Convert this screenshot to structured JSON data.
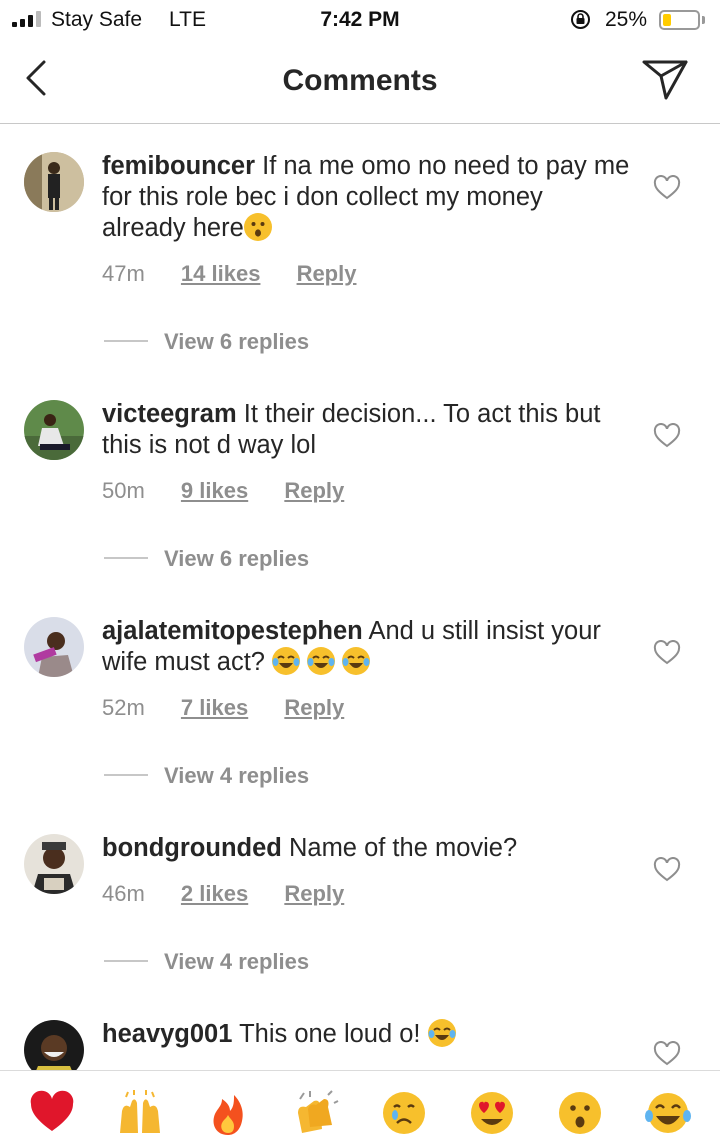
{
  "status_bar": {
    "carrier": "Stay Safe",
    "network": "LTE",
    "time": "7:42 PM",
    "battery_percent": "25%",
    "battery_level": 0.25
  },
  "nav": {
    "title": "Comments"
  },
  "comments": [
    {
      "username": "femibouncer",
      "text": "If na me omo no need to pay me for this role bec i don collect my money already here",
      "emoji": [
        "hushed-face"
      ],
      "time": "47m",
      "likes": "14 likes",
      "reply": "Reply",
      "view_replies": "View 6 replies"
    },
    {
      "username": "victeegram",
      "text": "It their decision... To act this but this is not d way lol",
      "emoji": [],
      "time": "50m",
      "likes": "9 likes",
      "reply": "Reply",
      "view_replies": "View 6 replies"
    },
    {
      "username": "ajalatemitopestephen",
      "text": "And u still insist your wife must act?",
      "emoji": [
        "tears-of-joy",
        "tears-of-joy",
        "tears-of-joy"
      ],
      "time": "52m",
      "likes": "7 likes",
      "reply": "Reply",
      "view_replies": "View 4 replies"
    },
    {
      "username": "bondgrounded",
      "text": "Name of the movie?",
      "emoji": [],
      "time": "46m",
      "likes": "2 likes",
      "reply": "Reply",
      "view_replies": "View 4 replies"
    },
    {
      "username": "heavyg001",
      "text": "This one loud o!",
      "emoji": [
        "tears-of-joy"
      ],
      "time": "",
      "likes": "",
      "reply": "",
      "view_replies": ""
    }
  ],
  "reactions": [
    {
      "name": "red-heart",
      "color": "#e0162b"
    },
    {
      "name": "raising-hands",
      "color": "#f5b731"
    },
    {
      "name": "fire",
      "color": "#f4511e"
    },
    {
      "name": "clapping-hands",
      "color": "#f5b731"
    },
    {
      "name": "crying-face",
      "color": "#f7c02c"
    },
    {
      "name": "heart-eyes",
      "color": "#f7c02c"
    },
    {
      "name": "hushed-face",
      "color": "#f7c02c"
    },
    {
      "name": "tears-of-joy",
      "color": "#f7c02c"
    }
  ],
  "colors": {
    "text": "#262626",
    "meta": "#8e8e8e",
    "divider": "#dbdbdb",
    "battery": "#ffcc00"
  }
}
